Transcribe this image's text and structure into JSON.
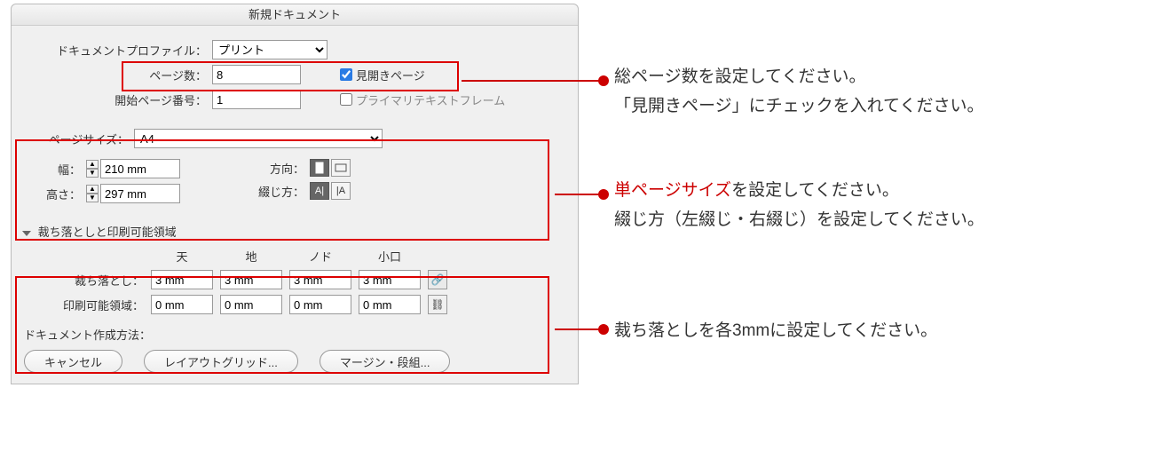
{
  "dialog": {
    "title": "新規ドキュメント",
    "profile_label": "ドキュメントプロファイル：",
    "profile_value": "プリント",
    "pages_label": "ページ数：",
    "pages_value": "8",
    "facing_label": "見開きページ",
    "startpage_label": "開始ページ番号：",
    "startpage_value": "1",
    "primary_label": "プライマリテキストフレーム",
    "pagesize_label": "ページサイズ：",
    "pagesize_value": "A4",
    "width_label": "幅：",
    "width_value": "210 mm",
    "height_label": "高さ：",
    "height_value": "297 mm",
    "orient_label": "方向：",
    "binding_label": "綴じ方：",
    "bleed_section": "裁ち落としと印刷可能領域",
    "col_top": "天",
    "col_bottom": "地",
    "col_inside": "ノド",
    "col_outside": "小口",
    "bleed_label": "裁ち落とし：",
    "bleed_top": "3 mm",
    "bleed_bottom": "3 mm",
    "bleed_inside": "3 mm",
    "bleed_outside": "3 mm",
    "slug_label": "印刷可能領域：",
    "slug_top": "0 mm",
    "slug_bottom": "0 mm",
    "slug_inside": "0 mm",
    "slug_outside": "0 mm",
    "method_label": "ドキュメント作成方法：",
    "btn_cancel": "キャンセル",
    "btn_grid": "レイアウトグリッド...",
    "btn_margin": "マージン・段組..."
  },
  "annotations": {
    "a1_line1": "総ページ数を設定してください。",
    "a1_line2": "「見開きページ」にチェックを入れてください。",
    "a2_red": "単ページサイズ",
    "a2_line1_rest": "を設定してください。",
    "a2_line2": "綴じ方（左綴じ・右綴じ）を設定してください。",
    "a3_line1": "裁ち落としを各3mmに設定してください。"
  }
}
